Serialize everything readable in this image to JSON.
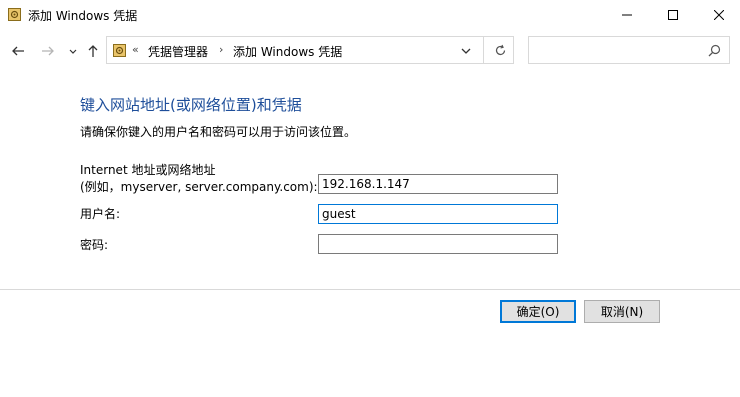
{
  "window": {
    "title": "添加 Windows 凭据"
  },
  "nav": {
    "breadcrumb_prefix": "«",
    "breadcrumbs": [
      "凭据管理器",
      "添加 Windows 凭据"
    ],
    "separator": "›",
    "search_placeholder": ""
  },
  "form": {
    "heading": "键入网站地址(或网络位置)和凭据",
    "subtext": "请确保你键入的用户名和密码可以用于访问该位置。",
    "address_label_line1": "Internet 地址或网络地址",
    "address_label_line2": "(例如，myserver, server.company.com):",
    "address_value": "192.168.1.147",
    "username_label": "用户名:",
    "username_value": "guest",
    "password_label": "密码:",
    "password_value": ""
  },
  "buttons": {
    "ok": "确定(O)",
    "cancel": "取消(N)"
  },
  "colors": {
    "heading": "#1e4e9a",
    "focus_border": "#0078d7"
  },
  "icons": [
    "credential-vault-icon",
    "back-arrow-icon",
    "forward-arrow-icon",
    "recent-dropdown-icon",
    "up-arrow-icon",
    "chevron-down-icon",
    "refresh-icon",
    "search-icon",
    "minimize-icon",
    "maximize-icon",
    "close-icon"
  ]
}
